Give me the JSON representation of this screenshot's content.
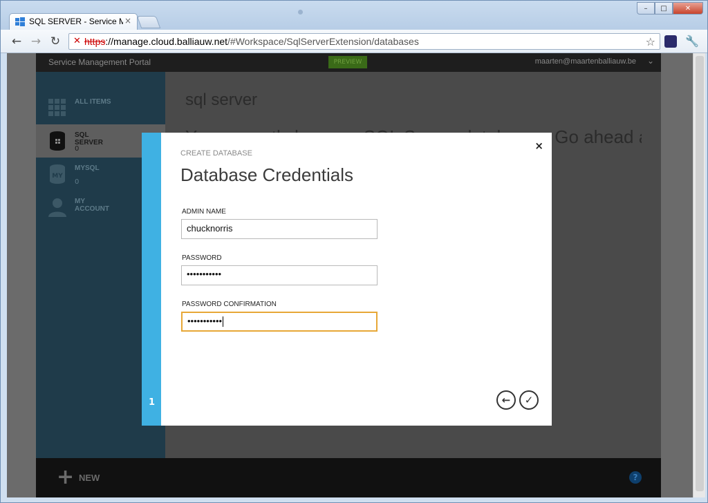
{
  "browser": {
    "tab_title": "SQL SERVER - Service Mana",
    "tab_close": "×",
    "url_scheme": "https",
    "url_host": "://manage.cloud.balliauw.net",
    "url_path": "/#Workspace/SqlServerExtension/databases",
    "back_glyph": "←",
    "forward_glyph": "→",
    "reload_glyph": "↻",
    "star_glyph": "☆",
    "wrench_glyph": "🔧",
    "min_glyph": "–",
    "max_glyph": "□",
    "close_glyph": "✕",
    "security_glyph": "✕"
  },
  "portal": {
    "title": "Service Management Portal",
    "preview": "PREVIEW",
    "user": "maarten@maartenballiauw.be",
    "user_chevron": "⌄",
    "sidebar": [
      {
        "label": "ALL ITEMS",
        "count": ""
      },
      {
        "label": "SQL SERVER",
        "count": "0"
      },
      {
        "label": "MYSQL",
        "count": "0"
      },
      {
        "label": "MY ACCOUNT",
        "count": ""
      }
    ],
    "mysql_icon_text": "MY",
    "content_title": "sql server",
    "content_subtitle": "You currently have no SQL Server databases. Go ahead and",
    "new_plus": "+",
    "new_label": "NEW",
    "help": "?"
  },
  "dialog": {
    "eyebrow": "CREATE DATABASE",
    "heading": "Database Credentials",
    "admin_label": "ADMIN NAME",
    "admin_value": "chucknorris",
    "password_label": "PASSWORD",
    "password_value": "•••••••••••",
    "confirm_label": "PASSWORD CONFIRMATION",
    "confirm_value": "•••••••••••",
    "step": "1",
    "close": "×",
    "back_glyph": "←",
    "ok_glyph": "✓"
  },
  "colors": {
    "accent_blue": "#3fb1e3",
    "focus_orange": "#e7a736",
    "sidebar_bg": "#1f3b4a"
  }
}
